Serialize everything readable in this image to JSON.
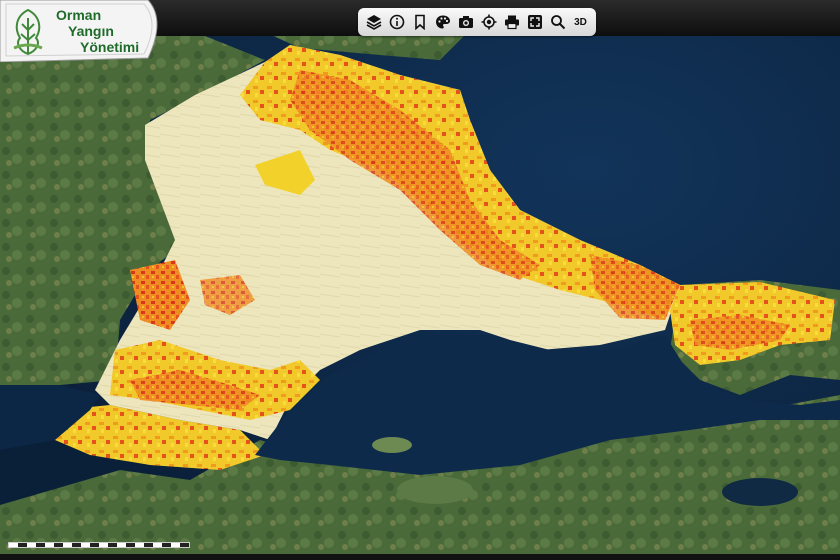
{
  "app": {
    "title_lines": [
      "Orman",
      "Yangın",
      "Yönetimi"
    ]
  },
  "toolbar": {
    "items": [
      {
        "icon": "layers-icon"
      },
      {
        "icon": "info-icon"
      },
      {
        "icon": "bookmark-icon"
      },
      {
        "icon": "palette-icon"
      },
      {
        "icon": "camera-icon"
      },
      {
        "icon": "locate-icon"
      },
      {
        "icon": "print-icon"
      },
      {
        "icon": "fullscreen-icon"
      },
      {
        "icon": "search-icon"
      },
      {
        "label": "3D"
      }
    ]
  },
  "legend_colors": {
    "land_base": "#efe9c2",
    "risk_low": "#f2d22a",
    "risk_medium": "#f29a1e",
    "risk_high": "#e2431c",
    "sea": "#0f2a4a",
    "forest": "#4f6f3e"
  }
}
